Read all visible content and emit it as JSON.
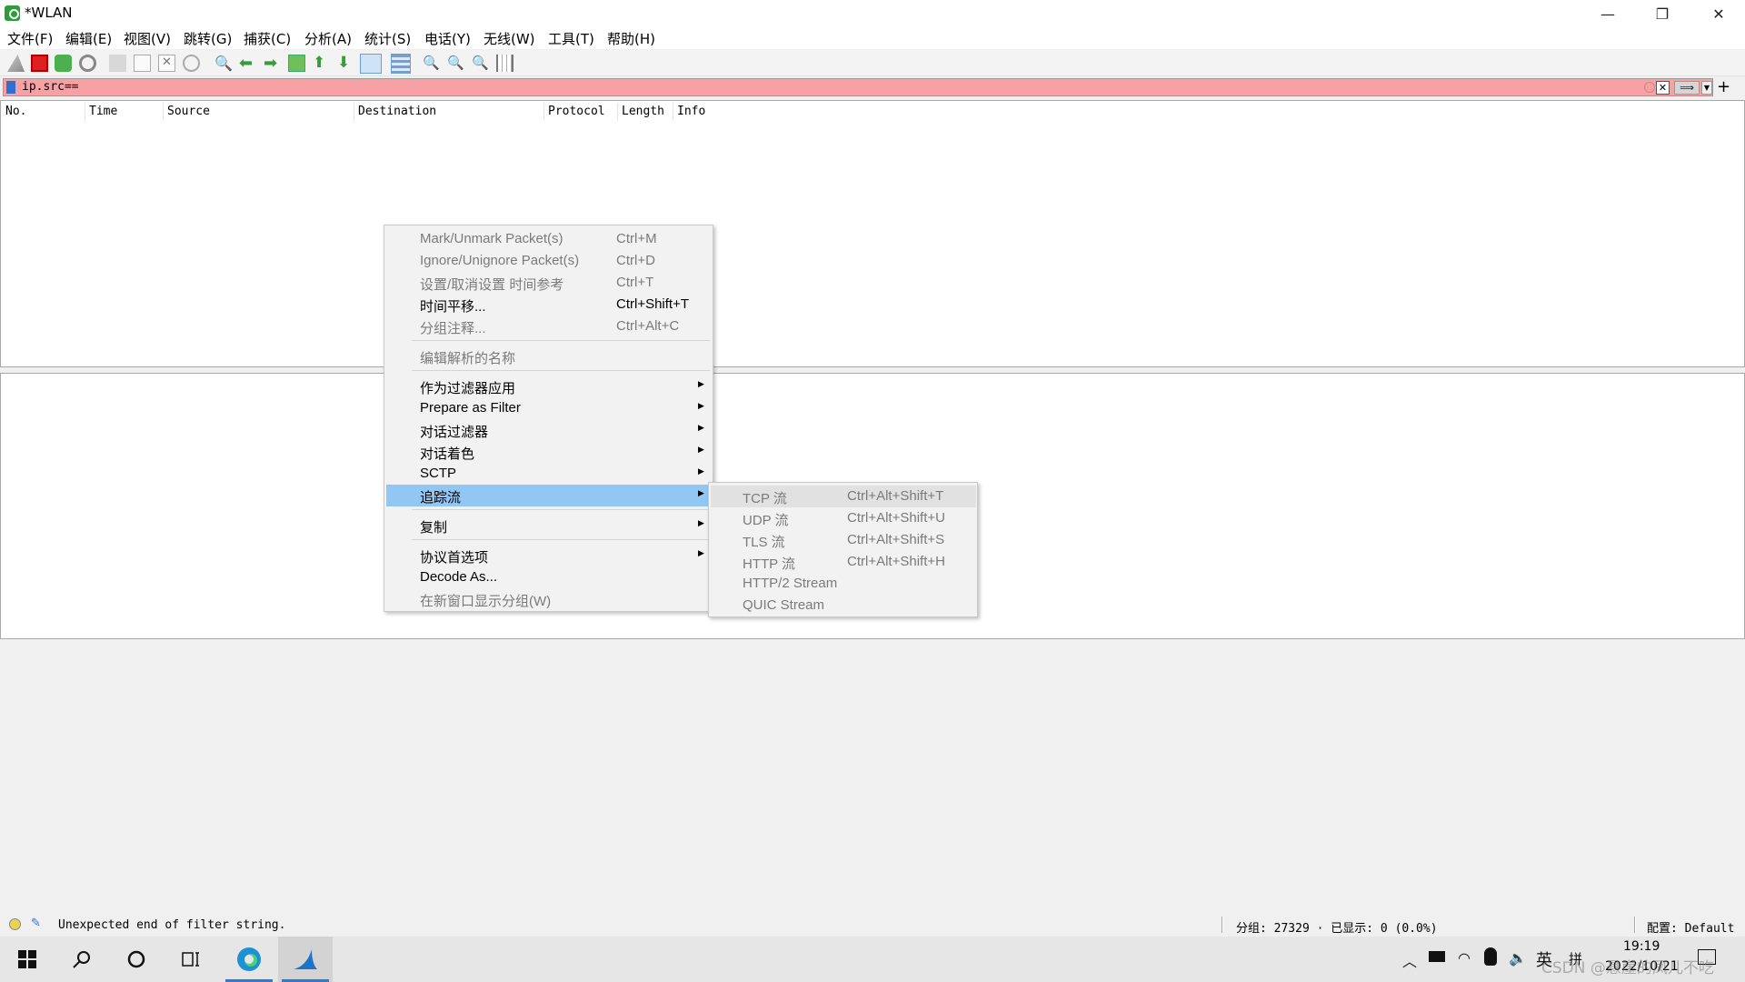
{
  "window": {
    "title": "*WLAN",
    "min": "—",
    "max": "❐",
    "close": "✕"
  },
  "menubar": [
    "文件(F)",
    "编辑(E)",
    "视图(V)",
    "跳转(G)",
    "捕获(C)",
    "分析(A)",
    "统计(S)",
    "电话(Y)",
    "无线(W)",
    "工具(T)",
    "帮助(H)"
  ],
  "toolbar_icons": [
    "shark-fin-start-icon",
    "stop-capture-icon",
    "restart-capture-icon",
    "capture-options-icon",
    "open-file-icon",
    "save-file-icon",
    "close-file-icon",
    "reload-file-icon",
    "find-packet-icon",
    "go-back-icon",
    "go-forward-icon",
    "go-to-packet-icon",
    "first-packet-icon",
    "last-packet-icon",
    "autoscroll-icon",
    "colorize-icon",
    "zoom-in-icon",
    "zoom-out-icon",
    "normal-size-icon",
    "resize-columns-icon"
  ],
  "filter": {
    "text": "ip.src==",
    "plus": "+"
  },
  "columns": [
    "No.",
    "Time",
    "Source",
    "Destination",
    "Protocol",
    "Length",
    "Info"
  ],
  "context_menu": {
    "items": [
      {
        "label": "Mark/Unmark Packet(s)",
        "shortcut": "Ctrl+M",
        "disabled": true
      },
      {
        "label": "Ignore/Unignore Packet(s)",
        "shortcut": "Ctrl+D",
        "disabled": true
      },
      {
        "label": "设置/取消设置 时间参考",
        "shortcut": "Ctrl+T",
        "disabled": true
      },
      {
        "label": "时间平移...",
        "shortcut": "Ctrl+Shift+T",
        "disabled": false
      },
      {
        "label": "分组注释...",
        "shortcut": "Ctrl+Alt+C",
        "disabled": true
      },
      {
        "label": "编辑解析的名称",
        "disabled": true
      },
      {
        "label": "作为过滤器应用",
        "submenu": true
      },
      {
        "label": "Prepare as Filter",
        "submenu": true
      },
      {
        "label": "对话过滤器",
        "submenu": true
      },
      {
        "label": "对话着色",
        "submenu": true
      },
      {
        "label": "SCTP",
        "submenu": true
      },
      {
        "label": "追踪流",
        "submenu": true,
        "highlighted": true
      },
      {
        "label": "复制",
        "submenu": true
      },
      {
        "label": "协议首选项",
        "submenu": true
      },
      {
        "label": "Decode As...",
        "disabled": false
      },
      {
        "label": "在新窗口显示分组(W)",
        "disabled": true
      }
    ]
  },
  "submenu": {
    "items": [
      {
        "label": "TCP 流",
        "shortcut": "Ctrl+Alt+Shift+T"
      },
      {
        "label": "UDP 流",
        "shortcut": "Ctrl+Alt+Shift+U"
      },
      {
        "label": "TLS 流",
        "shortcut": "Ctrl+Alt+Shift+S"
      },
      {
        "label": "HTTP 流",
        "shortcut": "Ctrl+Alt+Shift+H"
      },
      {
        "label": "HTTP/2 Stream"
      },
      {
        "label": "QUIC Stream"
      }
    ]
  },
  "statusbar": {
    "message": "Unexpected end of filter string.",
    "counts": "分组: 27329 · 已显示: 0 (0.0%)",
    "profile": "配置: Default"
  },
  "taskbar": {
    "time": "19:19",
    "date": "2022/10/21",
    "ime": "英",
    "ime_layout": "拼",
    "watermark": "CSDN @悬崖的凤儿不吃"
  },
  "colors": {
    "filter_invalid_bg": "#f7a1a5",
    "menu_highlight": "#92c6f3",
    "taskbar_active": "#2d7bd6"
  }
}
